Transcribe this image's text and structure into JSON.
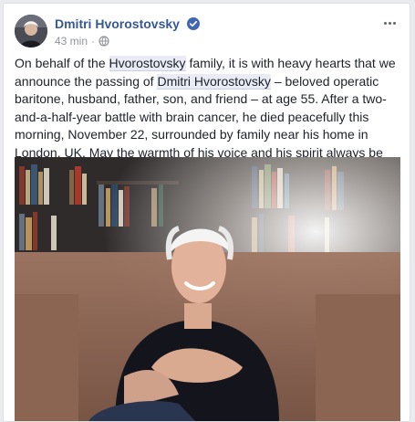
{
  "post": {
    "author": "Dmitri Hvorostovsky",
    "timestamp": "43 min",
    "separator": "·",
    "privacy_icon": "globe-icon",
    "verified_icon": "verified-badge-icon",
    "more_icon": "more-options-icon",
    "text": {
      "p1": "On behalf of the ",
      "tag1": "Hvorostovsky",
      "p2": " family, it is with heavy hearts that we announce the passing of ",
      "tag2": "Dmitri Hvorostovsky",
      "p3": " – beloved operatic baritone, husband, father, son, and friend – at age 55. After a two-and-a-half-year battle with brain cancer, he died peacefully this morning, November 22, surrounded by family near his home in London, UK. May the warmth of his voice and his spirit always be with us."
    }
  },
  "colors": {
    "author_link": "#365899",
    "verified_blue": "#4267b2",
    "meta_gray": "#90949c",
    "text": "#1d2129"
  }
}
